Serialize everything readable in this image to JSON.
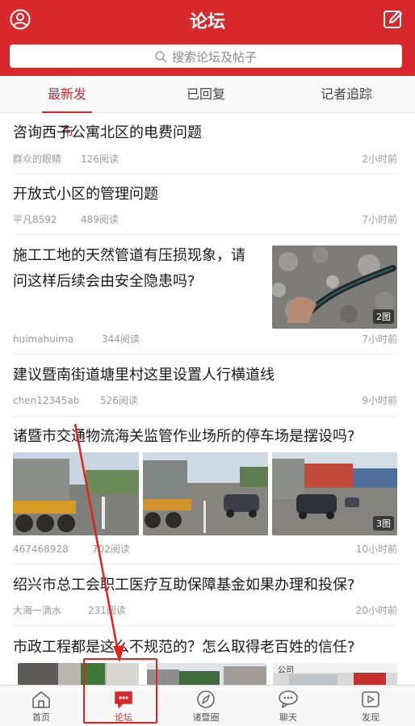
{
  "header": {
    "title": "论坛",
    "left_icon": "user-circle-icon",
    "right_icon": "edit-icon",
    "color": "#d8282c"
  },
  "search": {
    "placeholder": "搜索论坛及帖子"
  },
  "tabs": [
    {
      "label": "最新发布",
      "active": true
    },
    {
      "label": "已回复",
      "active": false
    },
    {
      "label": "记者追踪",
      "active": false
    }
  ],
  "posts": [
    {
      "title": "咨询西子公寓北区的电费问题",
      "author": "群众的眼睛",
      "views": "126阅读",
      "time": "2小时前"
    },
    {
      "title": "开放式小区的管理问题",
      "author": "平凡8592",
      "views": "489阅读",
      "time": "7小时前"
    },
    {
      "title_line1": "施工工地的天然管道有压损现象，请",
      "title_line2": "问这样后续会由安全隐患吗?",
      "author": "huimahuima",
      "views": "344阅读",
      "time": "7小时前",
      "image_count": "2图"
    },
    {
      "title": "建议暨南街道塘里村这里设置人行横道线",
      "author": "chen12345ab",
      "views": "526阅读",
      "time": "9小时前"
    },
    {
      "title": "诸暨市交通物流海关监管作业场所的停车场是摆设吗?",
      "author": "467468928",
      "views": "702阅读",
      "time": "10小时前",
      "image_count": "3图"
    },
    {
      "title": "绍兴市总工会职工医疗互助保障基金如果办理和投保?",
      "author": "大海一滴水",
      "views": "231阅读",
      "time": "20小时前"
    },
    {
      "title": "市政工程都是这么不规范的？怎么取得老百姓的信任?",
      "partial_image_text": "公司"
    }
  ],
  "tabbar": [
    {
      "label": "首页",
      "icon": "home-icon",
      "active": false
    },
    {
      "label": "论坛",
      "icon": "chat-bubble-icon",
      "active": true
    },
    {
      "label": "诸暨圈",
      "icon": "compass-icon",
      "active": false
    },
    {
      "label": "聊天",
      "icon": "chat-icon",
      "active": false
    },
    {
      "label": "发现",
      "icon": "play-icon",
      "active": false
    }
  ]
}
